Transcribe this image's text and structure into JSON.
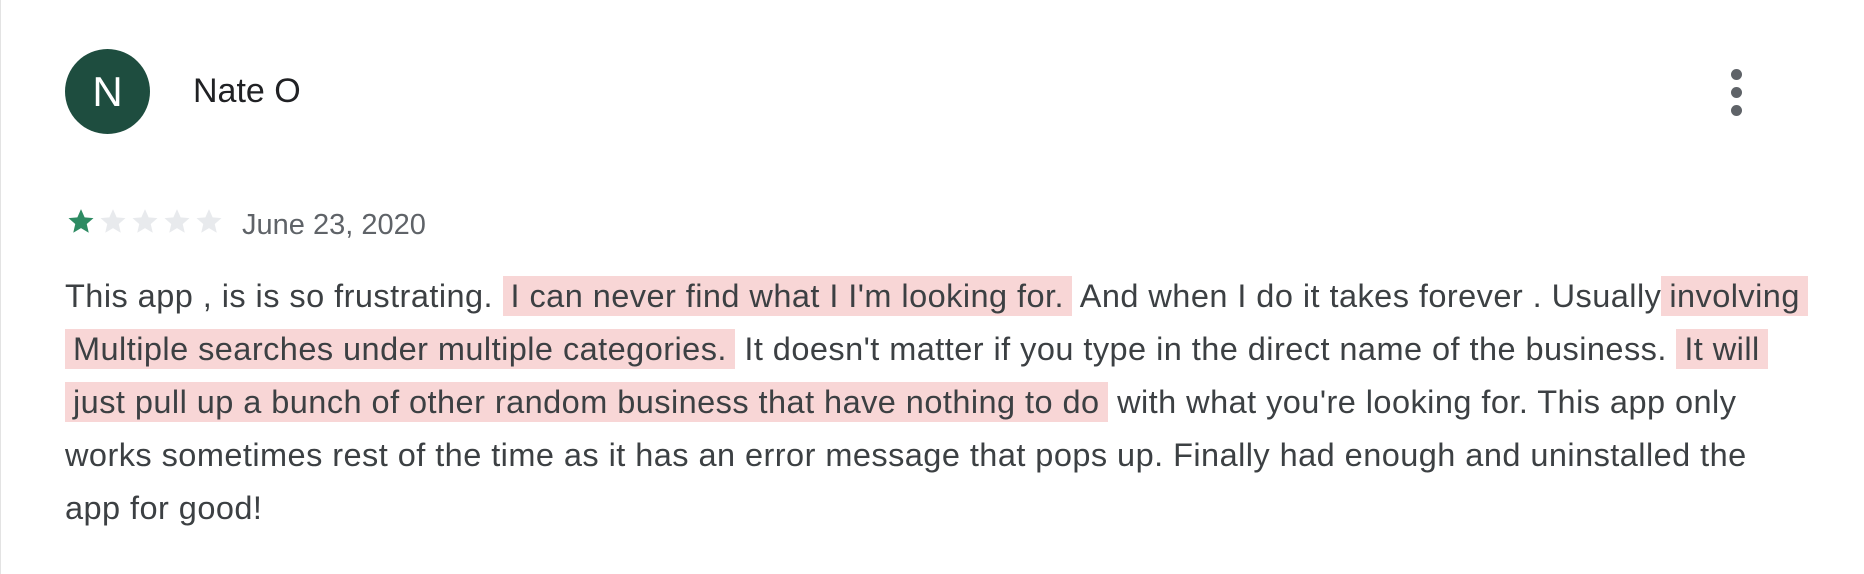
{
  "review": {
    "author": {
      "initial": "N",
      "name": "Nate O",
      "avatar_color": "#1e4d3f"
    },
    "menu_icon": "more-vert-icon",
    "rating": 1,
    "max_rating": 5,
    "star_filled_color": "#2e8b63",
    "star_empty_color": "#e8eaed",
    "date": "June 23, 2020",
    "highlight_color": "#f8d6d6",
    "text_segments": [
      {
        "text": "This app , is is so frustrating.",
        "highlight": false
      },
      {
        "text": "I can never find what I I'm looking for.",
        "highlight": true
      },
      {
        "text": "And when I do it takes forever . Usually",
        "highlight": false
      },
      {
        "text": "involving Multiple searches under multiple categories.",
        "highlight": true
      },
      {
        "text": "It doesn't matter if you type in the direct name of the business.",
        "highlight": false
      },
      {
        "text": "It will just pull up a bunch of other random business that have nothing to do",
        "highlight": true
      },
      {
        "text": "with what you're looking for. This app only works sometimes rest of the time as it has an error message that pops up. Finally had enough and uninstalled the app for good!",
        "highlight": false
      }
    ]
  }
}
